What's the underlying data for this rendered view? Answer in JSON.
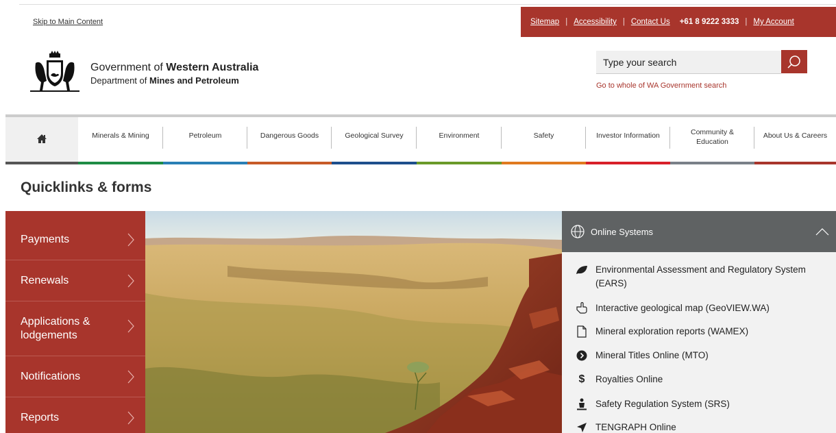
{
  "skip_link": "Skip to Main Content",
  "utility": {
    "sitemap": "Sitemap",
    "accessibility": "Accessibility",
    "contact": "Contact Us",
    "phone": "+61 8 9222 3333",
    "account": "My Account"
  },
  "brand": {
    "gov_prefix": "Government of ",
    "gov_bold": "Western Australia",
    "dept_prefix": "Department of ",
    "dept_bold": "Mines and Petroleum"
  },
  "search": {
    "placeholder": "Type your search",
    "wa_link": "Go to whole of WA Government search"
  },
  "nav": [
    {
      "label": "",
      "color": "#555555"
    },
    {
      "label": "Minerals & Mining",
      "color": "#1e8c45"
    },
    {
      "label": "Petroleum",
      "color": "#2a7fb5"
    },
    {
      "label": "Dangerous Goods",
      "color": "#c75a28"
    },
    {
      "label": "Geological Survey",
      "color": "#1d4f8c"
    },
    {
      "label": "Environment",
      "color": "#6a9a2a"
    },
    {
      "label": "Safety",
      "color": "#e07a1f"
    },
    {
      "label": "Investor Information",
      "color": "#d8202a"
    },
    {
      "label": "Community & Education",
      "color": "#7a8088"
    },
    {
      "label": "About Us & Careers",
      "color": "#a8352c"
    }
  ],
  "quicklinks_title": "Quicklinks & forms",
  "side_menu": [
    {
      "label": "Payments"
    },
    {
      "label": "Renewals"
    },
    {
      "label": "Applications & lodgements"
    },
    {
      "label": "Notifications"
    },
    {
      "label": "Reports"
    }
  ],
  "online_systems": {
    "title": "Online Systems",
    "items": [
      {
        "label": "Environmental Assessment and Regulatory System (EARS)",
        "icon": "leaf-icon"
      },
      {
        "label": "Interactive geological map (GeoVIEW.WA)",
        "icon": "hand-pointer-icon"
      },
      {
        "label": "Mineral exploration reports (WAMEX)",
        "icon": "document-icon"
      },
      {
        "label": "Mineral Titles Online (MTO)",
        "icon": "play-circle-icon"
      },
      {
        "label": "Royalties Online",
        "icon": "dollar-icon"
      },
      {
        "label": "Safety Regulation System (SRS)",
        "icon": "worker-icon"
      },
      {
        "label": "TENGRAPH Online",
        "icon": "location-arrow-icon"
      }
    ]
  },
  "colors": {
    "brand_red": "#a8352c",
    "panel_grey": "#5f6263"
  }
}
